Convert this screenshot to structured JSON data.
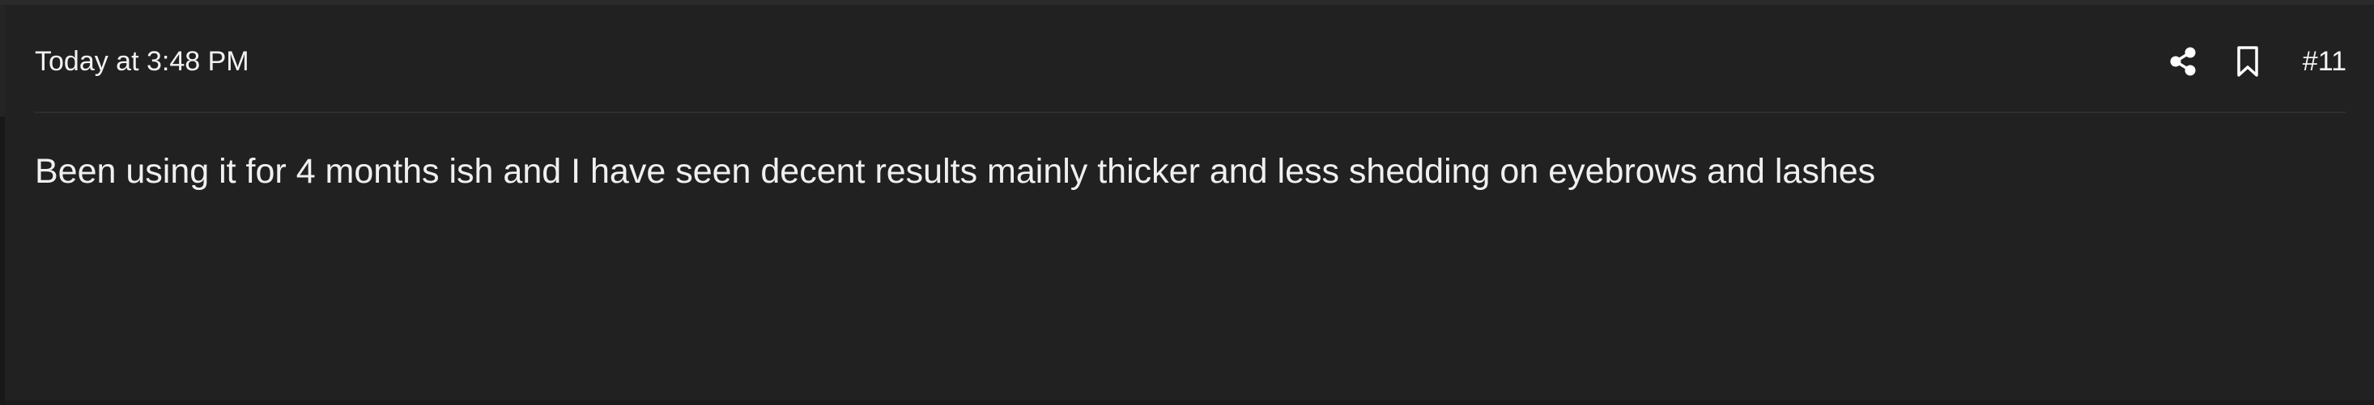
{
  "post": {
    "timestamp": "Today at 3:48 PM",
    "post_number": "#11",
    "body": "Been using it for 4 months ish and I have seen decent results mainly thicker and less shedding on eyebrows and lashes"
  },
  "actions": {
    "share_icon": "share-icon",
    "bookmark_icon": "bookmark-icon"
  },
  "colors": {
    "background": "#212121",
    "divider": "#2e2e2e",
    "text": "#f0f0f0"
  }
}
